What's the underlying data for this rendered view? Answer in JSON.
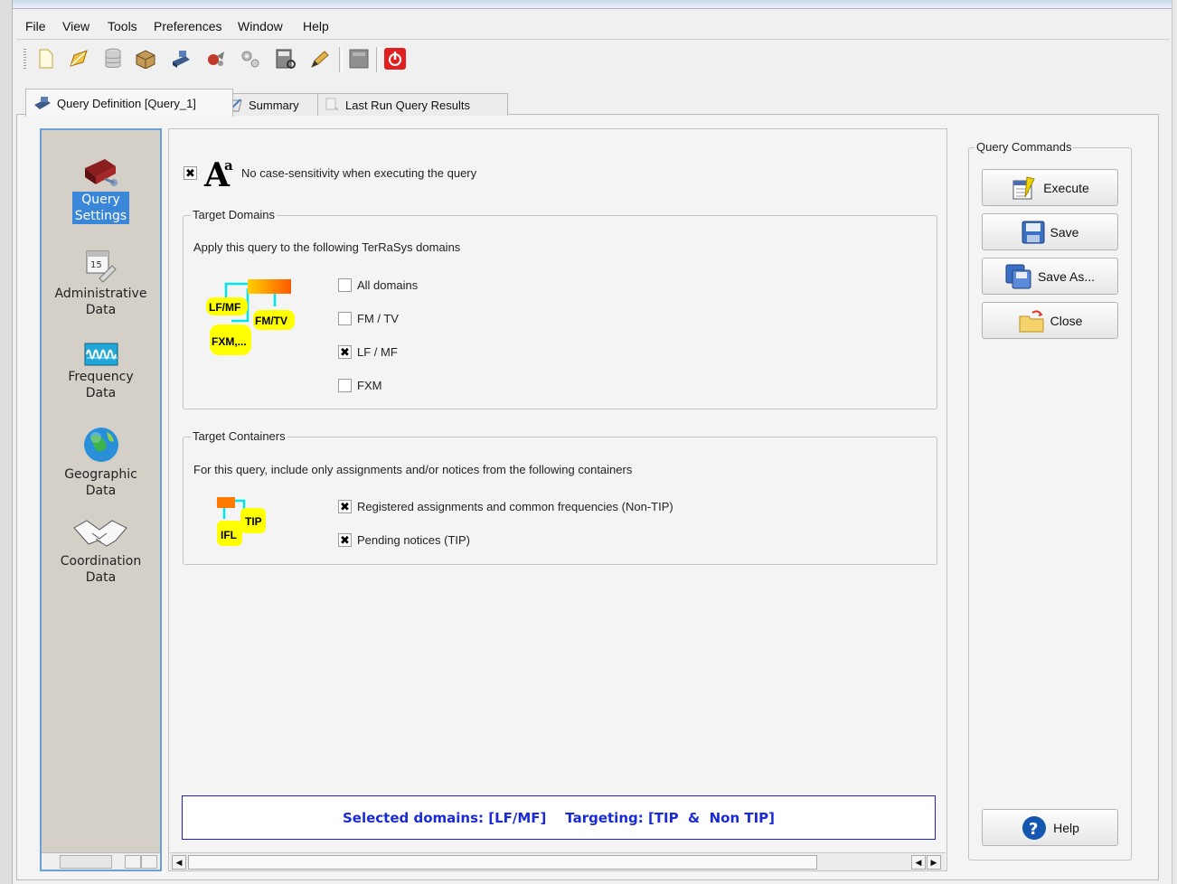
{
  "menu": [
    "File",
    "View",
    "Tools",
    "Preferences",
    "Window",
    "Help"
  ],
  "toolbar": {
    "icons": [
      "new-document-icon",
      "edit-icon",
      "database-icon",
      "package-icon",
      "stamp-icon",
      "run-icon",
      "settings-gears-icon",
      "calculator-icon",
      "pencil-icon",
      "disabled-icon",
      "power-exit-icon"
    ]
  },
  "tabs": [
    {
      "label": "Query Definition [Query_1]",
      "icon": "query-definition-icon",
      "active": true
    },
    {
      "label": "Summary",
      "icon": "summary-icon",
      "active": false
    },
    {
      "label": "Last Run Query Results",
      "icon": "results-icon",
      "active": false
    }
  ],
  "nav": {
    "items": [
      {
        "line1": "Query",
        "line2": "Settings",
        "icon": "toolbox-icon",
        "selected": true
      },
      {
        "line1": "Administrative",
        "line2": "Data",
        "icon": "calendar-icon",
        "selected": false
      },
      {
        "line1": "Frequency",
        "line2": "Data",
        "icon": "frequency-icon",
        "selected": false
      },
      {
        "line1": "Geographic",
        "line2": "Data",
        "icon": "globe-icon",
        "selected": false
      },
      {
        "line1": "Coordination",
        "line2": "Data",
        "icon": "handshake-icon",
        "selected": false
      }
    ]
  },
  "case": {
    "checked": true,
    "label": "No case-sensitivity when executing the query"
  },
  "domains": {
    "title": "Target Domains",
    "description": "Apply this query to the following TerRaSys domains",
    "diagram": {
      "lfmf": "LF/MF",
      "fmtv": "FM/TV",
      "fxm": "FXM,..."
    },
    "options": [
      {
        "label": "All domains",
        "checked": false
      },
      {
        "label": "FM / TV",
        "checked": false
      },
      {
        "label": "LF / MF",
        "checked": true
      },
      {
        "label": "FXM",
        "checked": false
      }
    ]
  },
  "containers": {
    "title": "Target Containers",
    "description": "For this query, include only assignments and/or notices from the following containers",
    "diagram": {
      "tip": "TIP",
      "ifl": "IFL"
    },
    "options": [
      {
        "label": "Registered assignments and common frequencies (Non-TIP)",
        "checked": true
      },
      {
        "label": "Pending notices (TIP)",
        "checked": true
      }
    ]
  },
  "status": "Selected domains: [LF/MF]    Targeting: [TIP  &  Non TIP]",
  "commands": {
    "title": "Query Commands",
    "buttons": [
      {
        "label": "Execute",
        "icon": "execute-icon"
      },
      {
        "label": "Save",
        "icon": "save-icon"
      },
      {
        "label": "Save As...",
        "icon": "save-as-icon"
      },
      {
        "label": "Close",
        "icon": "folder-close-icon"
      }
    ],
    "help": "Help"
  },
  "check_mark": "✖",
  "colors": {
    "accent": "#3a86d8",
    "status_text": "#1a2bd6",
    "diagram_yellow": "#ffff00",
    "diagram_cyan": "#00e5ee"
  }
}
